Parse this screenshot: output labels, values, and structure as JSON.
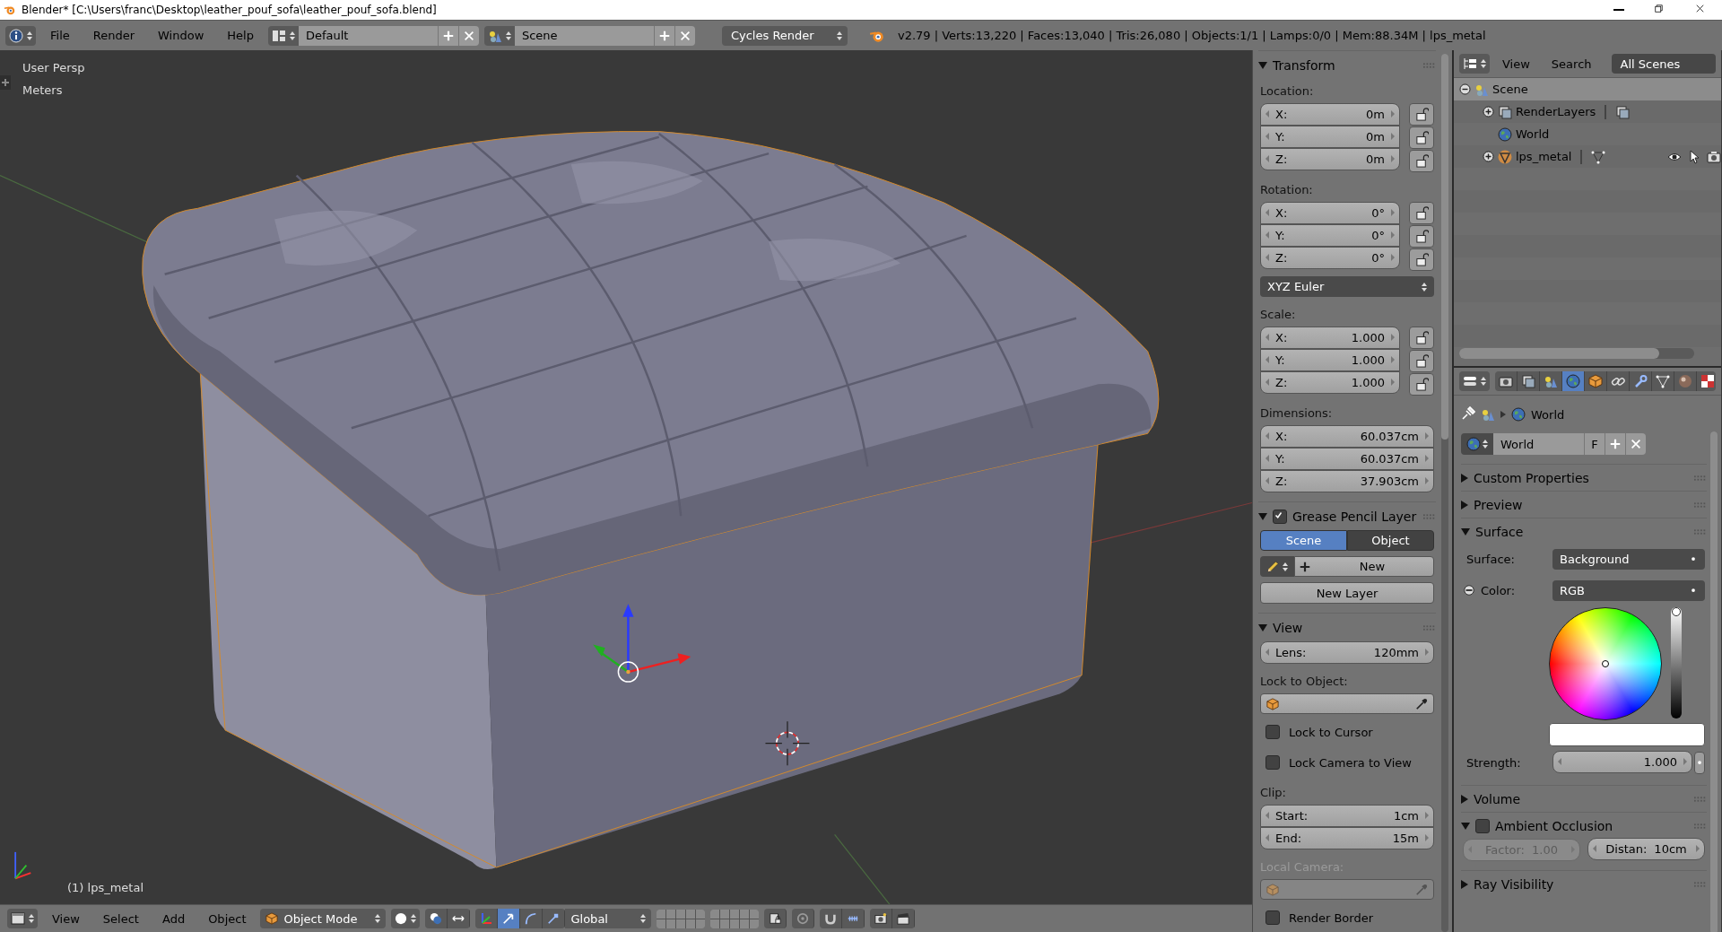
{
  "window": {
    "title": "Blender* [C:\\Users\\franc\\Desktop\\leather_pouf_sofa\\leather_pouf_sofa.blend]"
  },
  "info_header": {
    "menus": [
      "File",
      "Render",
      "Window",
      "Help"
    ],
    "screen_layout": "Default",
    "scene": "Scene",
    "render_engine": "Cycles Render",
    "stats": "v2.79 | Verts:13,220 | Faces:13,040 | Tris:26,080 | Objects:1/1 | Lamps:0/0 | Mem:88.34M | lps_metal"
  },
  "viewport": {
    "view_name": "User Persp",
    "units": "Meters",
    "active_object": "(1) lps_metal"
  },
  "n_panel": {
    "panels": [
      {
        "title": "Transform",
        "kind": "plain",
        "expanded": true,
        "rows": [
          {
            "kind": "heading",
            "text": "Location:",
            "disabled": false
          },
          {
            "kind": "fields",
            "locks": true,
            "items": [
              {
                "label": "X:",
                "value": "0m"
              },
              {
                "label": "Y:",
                "value": "0m"
              },
              {
                "label": "Z:",
                "value": "0m"
              }
            ]
          },
          {
            "kind": "heading",
            "text": "Rotation:",
            "disabled": false
          },
          {
            "kind": "fields",
            "locks": true,
            "items": [
              {
                "label": "X:",
                "value": "0°"
              },
              {
                "label": "Y:",
                "value": "0°"
              },
              {
                "label": "Z:",
                "value": "0°"
              }
            ]
          },
          {
            "kind": "dropdown",
            "value": "XYZ Euler"
          },
          {
            "kind": "heading",
            "text": "Scale:",
            "disabled": false
          },
          {
            "kind": "fields",
            "locks": true,
            "items": [
              {
                "label": "X:",
                "value": "1.000"
              },
              {
                "label": "Y:",
                "value": "1.000"
              },
              {
                "label": "Z:",
                "value": "1.000"
              }
            ]
          },
          {
            "kind": "heading",
            "text": "Dimensions:",
            "disabled": false
          },
          {
            "kind": "fields",
            "locks": false,
            "items": [
              {
                "label": "X:",
                "value": "60.037cm"
              },
              {
                "label": "Y:",
                "value": "60.037cm"
              },
              {
                "label": "Z:",
                "value": "37.903cm"
              }
            ]
          }
        ]
      },
      {
        "title": "Grease Pencil Layer",
        "kind": "checkbox",
        "checked": true,
        "expanded": true,
        "rows": [
          {
            "kind": "toggle",
            "options": [
              {
                "label": "Scene",
                "selected": true
              },
              {
                "label": "Object",
                "selected": false
              }
            ]
          },
          {
            "kind": "new",
            "label": "New"
          },
          {
            "kind": "button",
            "label": "New Layer"
          }
        ]
      },
      {
        "title": "View",
        "kind": "plain",
        "expanded": true,
        "rows": [
          {
            "kind": "fields",
            "locks": false,
            "items": [
              {
                "label": "Lens:",
                "value": "120mm"
              }
            ]
          },
          {
            "kind": "heading",
            "text": "Lock to Object:",
            "disabled": false
          },
          {
            "kind": "object_field",
            "disabled": false
          },
          {
            "kind": "checkbox",
            "label": "Lock to Cursor",
            "checked": false
          },
          {
            "kind": "checkbox",
            "label": "Lock Camera to View",
            "checked": false
          },
          {
            "kind": "heading",
            "text": "Clip:",
            "disabled": false
          },
          {
            "kind": "fields",
            "locks": false,
            "items": [
              {
                "label": "Start:",
                "value": "1cm"
              },
              {
                "label": "End:",
                "value": "15m"
              }
            ]
          },
          {
            "kind": "heading",
            "text": "Local Camera:",
            "disabled": true
          },
          {
            "kind": "object_field",
            "disabled": true
          },
          {
            "kind": "checkbox",
            "label": "Render Border",
            "checked": false
          }
        ]
      }
    ]
  },
  "outliner": {
    "menus": [
      "View",
      "Search"
    ],
    "display_mode": "All Scenes",
    "tree": [
      {
        "name": "Scene",
        "kind": "scene",
        "expanded": true,
        "selected": true,
        "children": [
          {
            "name": "RenderLayers",
            "kind": "renderlayers",
            "expanded": false,
            "selected": false
          },
          {
            "name": "World",
            "kind": "world",
            "selected": false
          },
          {
            "name": "lps_metal",
            "kind": "object",
            "expanded": false,
            "selected": false
          }
        ]
      }
    ]
  },
  "properties": {
    "tabs": [
      {
        "kind": "render",
        "selected": false
      },
      {
        "kind": "render_layers",
        "selected": false
      },
      {
        "kind": "scene",
        "selected": false
      },
      {
        "kind": "world",
        "selected": true
      },
      {
        "kind": "object",
        "selected": false
      },
      {
        "kind": "constraints",
        "selected": false
      },
      {
        "kind": "modifiers",
        "selected": false
      },
      {
        "kind": "data",
        "selected": false
      },
      {
        "kind": "material",
        "selected": false
      },
      {
        "kind": "texture",
        "selected": false
      }
    ],
    "context": "World",
    "world_name": "World",
    "fake_user": "F",
    "panels": [
      {
        "title": "Custom Properties",
        "kind": "plain",
        "expanded": false
      },
      {
        "title": "Preview",
        "kind": "plain",
        "expanded": false
      },
      {
        "title": "Surface",
        "kind": "plain",
        "expanded": true,
        "rows": [
          {
            "kind": "select",
            "label": "Surface:",
            "value": "Background",
            "socket": false
          },
          {
            "kind": "select",
            "label": "Color:",
            "value": "RGB",
            "socket": true
          },
          {
            "kind": "color_wheel",
            "level": 1
          },
          {
            "kind": "number",
            "label": "Strength:",
            "value": "1.000"
          }
        ]
      },
      {
        "title": "Volume",
        "kind": "plain",
        "expanded": false
      },
      {
        "title": "Ambient Occlusion",
        "kind": "checkbox",
        "checked": false,
        "expanded": true,
        "rows": [
          {
            "kind": "pair",
            "items": [
              {
                "label": "Factor:",
                "value": "1.00",
                "disabled": true
              },
              {
                "label": "Distan:",
                "value": "10cm",
                "disabled": false
              }
            ]
          }
        ]
      },
      {
        "title": "Ray Visibility",
        "kind": "plain",
        "expanded": false
      }
    ]
  },
  "view3d_header": {
    "menus": [
      "View",
      "Select",
      "Add",
      "Object"
    ],
    "mode": "Object Mode",
    "manipulators": [
      {
        "kind": "translate",
        "selected": true
      },
      {
        "kind": "rotate",
        "selected": false
      },
      {
        "kind": "scale",
        "selected": false
      }
    ],
    "orientation": "Global"
  }
}
